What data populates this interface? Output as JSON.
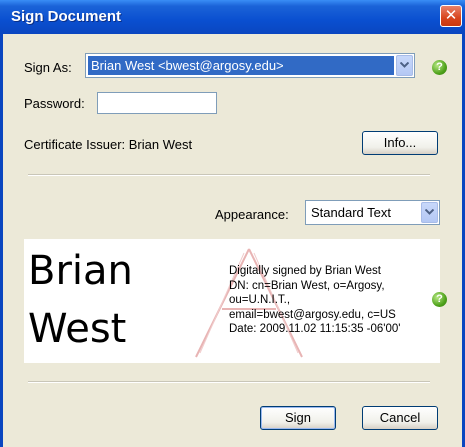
{
  "window": {
    "title": "Sign Document",
    "close_glyph": "✕"
  },
  "sign_as": {
    "label": "Sign As:",
    "value": "Brian West <bwest@argosy.edu>"
  },
  "password": {
    "label": "Password:",
    "value": ""
  },
  "certificate": {
    "issuer_text": "Certificate Issuer: Brian West",
    "info_button": "Info..."
  },
  "appearance": {
    "label": "Appearance:",
    "value": "Standard Text"
  },
  "signature_preview": {
    "name_line1": "Brian",
    "name_line2": "West",
    "details": [
      "Digitally signed by Brian West",
      "DN: cn=Brian West, o=Argosy,",
      "ou=U.N.I.T.,",
      "email=bwest@argosy.edu, c=US",
      "Date: 2009.11.02 11:15:35 -06'00'"
    ]
  },
  "help": {
    "glyph": "?"
  },
  "buttons": {
    "sign": "Sign",
    "cancel": "Cancel"
  },
  "colors": {
    "titlebar": "#0a4fd0",
    "selection": "#316ac5",
    "help_green": "#4fa21b",
    "close_red": "#d8451c",
    "watermark": "#e8b4b4"
  }
}
